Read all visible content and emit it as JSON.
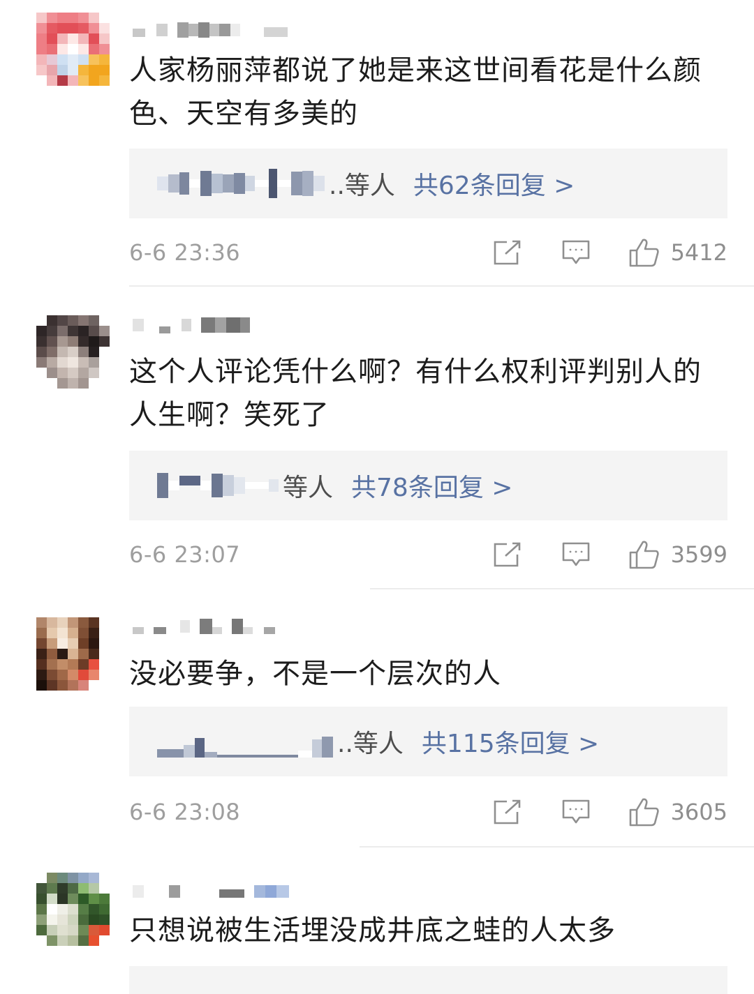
{
  "comments": [
    {
      "text": "人家杨丽萍都说了她是来这世间看花是什么颜色、天空有多美的",
      "reply_others": "..等人",
      "reply_count": "共62条回复 >",
      "time": "6-6 23:36",
      "likes": "5412"
    },
    {
      "text": "这个人评论凭什么啊？有什么权利评判别人的人生啊？笑死了",
      "reply_others": "等人",
      "reply_count": "共78条回复 >",
      "time": "6-6 23:07",
      "likes": "3599"
    },
    {
      "text": "没必要争，不是一个层次的人",
      "reply_others": "..等人",
      "reply_count": "共115条回复 >",
      "time": "6-6 23:08",
      "likes": "3605"
    },
    {
      "text": "只想说被生活埋没成井底之蛙的人太多"
    }
  ],
  "icons": {
    "share": "share-icon",
    "comment": "comment-icon",
    "like": "thumbs-up-icon"
  },
  "colors": {
    "reply_link": "#5872a3",
    "meta_gray": "#9e9e9e",
    "reply_bg": "#f4f4f4"
  }
}
